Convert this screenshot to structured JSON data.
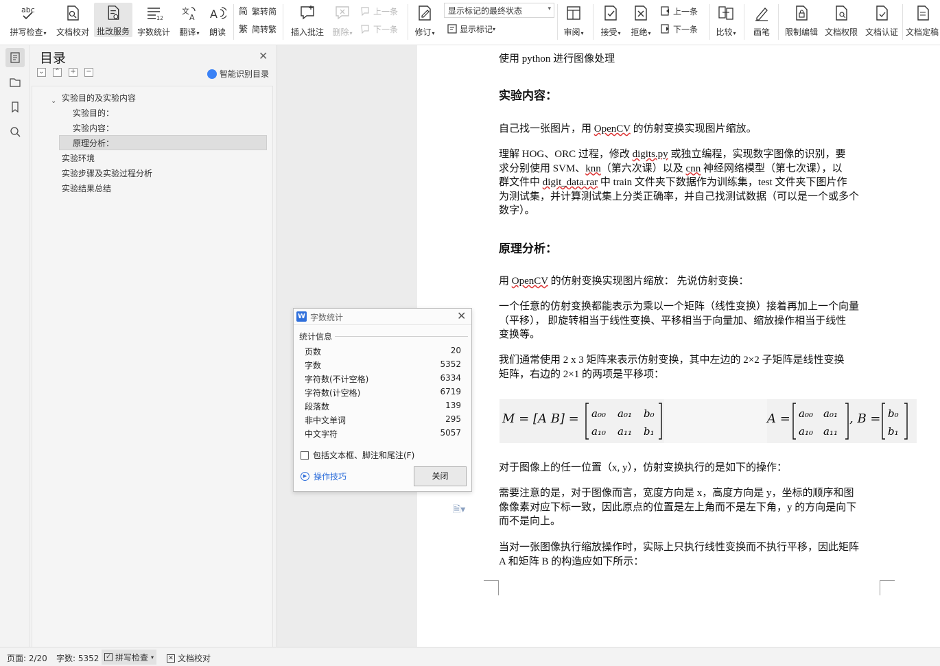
{
  "ribbon": {
    "buttons": [
      {
        "id": "spell",
        "label": "拼写检查",
        "caret": true,
        "icon": "spellcheck-icon"
      },
      {
        "id": "proof",
        "label": "文档校对",
        "caret": false,
        "icon": "proofread-icon"
      },
      {
        "id": "review_service",
        "label": "批改服务",
        "caret": false,
        "icon": "review-service-icon",
        "active": true
      },
      {
        "id": "wordcount",
        "label": "字数统计",
        "caret": false,
        "icon": "word-count-icon"
      },
      {
        "id": "translate",
        "label": "翻译",
        "caret": true,
        "icon": "translate-icon"
      },
      {
        "id": "read",
        "label": "朗读",
        "caret": false,
        "icon": "read-aloud-icon"
      },
      {
        "id": "insert_comment",
        "label": "插入批注",
        "caret": false,
        "icon": "insert-comment-icon"
      },
      {
        "id": "delete",
        "label": "删除",
        "caret": true,
        "icon": "delete-comment-icon",
        "disabled": true
      },
      {
        "id": "revise",
        "label": "修订",
        "caret": true,
        "icon": "track-changes-icon"
      },
      {
        "id": "review",
        "label": "审阅",
        "caret": true,
        "icon": "review-pane-icon"
      },
      {
        "id": "accept",
        "label": "接受",
        "caret": true,
        "icon": "accept-icon"
      },
      {
        "id": "reject",
        "label": "拒绝",
        "caret": true,
        "icon": "reject-icon"
      },
      {
        "id": "compare",
        "label": "比较",
        "caret": true,
        "icon": "compare-icon"
      },
      {
        "id": "pen",
        "label": "画笔",
        "caret": false,
        "icon": "pen-icon"
      },
      {
        "id": "restrict",
        "label": "限制编辑",
        "caret": false,
        "icon": "restrict-edit-icon"
      },
      {
        "id": "doc_perm",
        "label": "文档权限",
        "caret": false,
        "icon": "document-permission-icon"
      },
      {
        "id": "doc_cert",
        "label": "文档认证",
        "caret": false,
        "icon": "document-certify-icon"
      },
      {
        "id": "doc_final",
        "label": "文档定稿",
        "caret": false,
        "icon": "document-finalize-icon"
      }
    ],
    "small": {
      "trad_to_simp": "繁转简",
      "simp_to_trad": "简转繁",
      "prev_comment": "上一条",
      "next_comment": "下一条",
      "show_markup": "显示标记",
      "prev_change": "上一条",
      "next_change": "下一条"
    },
    "markup_select": "显示标记的最终状态"
  },
  "toc": {
    "title": "目录",
    "smart_label": "智能识别目录",
    "items": [
      "实验目的及实验内容",
      "实验目的：",
      "实验内容：",
      "原理分析：",
      "实验环境",
      "实验步骤及实验过程分析",
      "实验结果总结"
    ]
  },
  "document": {
    "p1": "使用 python 进行图像处理",
    "h1": "实验内容：",
    "p2a": "自己找一张图片，用 ",
    "p2b": "OpenCV",
    "p2c": " 的仿射变换实现图片缩放。",
    "p3l1a": "理解 HOG、ORC 过程，修改 ",
    "p3l1b": "digits.py",
    "p3l1c": " 或独立编程，实现数字图像的识别，要",
    "p3l2a": "求分别使用 SVM、",
    "p3l2b": "knn",
    "p3l2c": "（第六次课）以及 ",
    "p3l2d": "cnn",
    "p3l2e": " 神经网络模型（第七次课），以",
    "p3l3a": "群文件中 ",
    "p3l3b": "digit_data.rar",
    "p3l3c": " 中 train 文件夹下数据作为训练集，test 文件夹下图片作",
    "p3l4": "为测试集，并计算测试集上分类正确率，并自己找测试数据（可以是一个或多个",
    "p3l5": "数字）。",
    "h2": "原理分析：",
    "p4a": "用 ",
    "p4b": "OpenCV",
    "p4c": " 的仿射变换实现图片缩放： 先说仿射变换：",
    "p5l1": "一个任意的仿射变换都能表示为乘以一个矩阵（线性变换）接着再加上一个向量",
    "p5l2": "（平移）， 即旋转相当于线性变换、平移相当于向量加、缩放操作相当于线性",
    "p5l3": "变换等。",
    "p6l1": "我们通常使用 2 x 3 矩阵来表示仿射变换，其中左边的 2×2 子矩阵是线性变换",
    "p6l2": "矩阵，右边的 2×1 的两项是平移项：",
    "formula_left": "M = [A   B] =",
    "formula_right": "A =",
    "formula_b": ", B =",
    "p7": "对于图像上的任一位置（x, y），仿射变换执行的是如下的操作：",
    "p8l1": "需要注意的是，对于图像而言，宽度方向是 x，高度方向是 y，坐标的顺序和图",
    "p8l2": "像像素对应下标一致，因此原点的位置是左上角而不是左下角，y 的方向是向下",
    "p8l3": "而不是向上。",
    "p9l1": "当对一张图像执行缩放操作时，实际上只执行线性变换而不执行平移，因此矩阵",
    "p9l2": "A 和矩阵 B 的构造应如下所示："
  },
  "dialog": {
    "title": "字数统计",
    "section": "统计信息",
    "rows": [
      {
        "label": "页数",
        "value": "20"
      },
      {
        "label": "字数",
        "value": "5352"
      },
      {
        "label": "字符数(不计空格)",
        "value": "6334"
      },
      {
        "label": "字符数(计空格)",
        "value": "6719"
      },
      {
        "label": "段落数",
        "value": "139"
      },
      {
        "label": "非中文单词",
        "value": "295"
      },
      {
        "label": "中文字符",
        "value": "5057"
      }
    ],
    "checkbox": "包括文本框、脚注和尾注(F)",
    "tips": "操作技巧",
    "close": "关闭"
  },
  "status": {
    "page": "页面: 2/20",
    "words": "字数: 5352",
    "spell": "拼写检查",
    "proof": "文档校对"
  }
}
